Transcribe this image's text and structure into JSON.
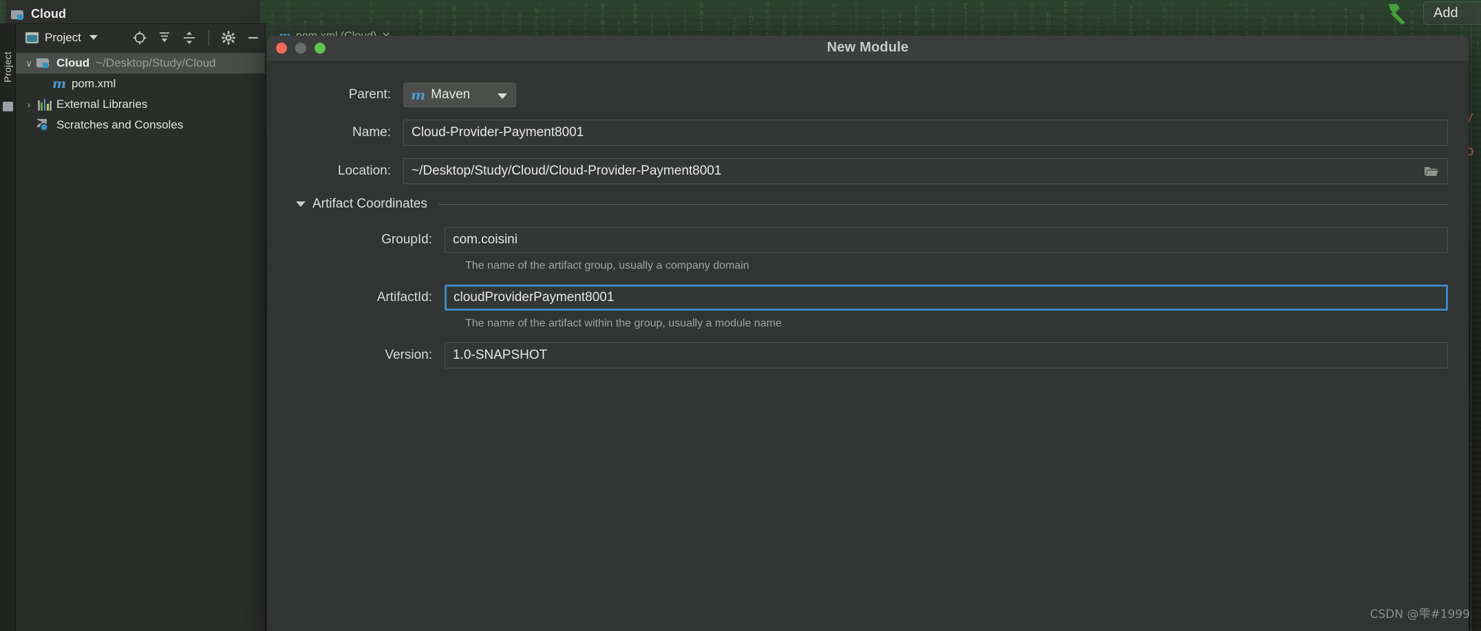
{
  "ide": {
    "project_badge": {
      "label": "Cloud",
      "icon": "folder-icon"
    },
    "topbar": {
      "build_icon": "hammer-icon",
      "add_button": "Add"
    },
    "tool_strip": {
      "label": "Project"
    },
    "panel": {
      "tab_label": "Project",
      "tab_icon": "project-view-icon",
      "dropdown_icon": "chevron-down-icon",
      "toolbar_icons": [
        "locate-target-icon",
        "expand-all-icon",
        "collapse-all-icon",
        "settings-gear-icon",
        "minimize-icon"
      ]
    },
    "tree": [
      {
        "twisty": "⌄",
        "icon": "folder-icon",
        "label": "Cloud",
        "sub": "~/Desktop/Study/Cloud",
        "selected": true,
        "indent": 1
      },
      {
        "twisty": "",
        "icon": "maven-icon",
        "label": "pom.xml",
        "sub": "",
        "selected": false,
        "indent": 2
      },
      {
        "twisty": "›",
        "icon": "libraries-icon",
        "label": "External Libraries",
        "sub": "",
        "selected": false,
        "indent": 1
      },
      {
        "twisty": "",
        "icon": "scratches-icon",
        "label": "Scratches and Consoles",
        "sub": "",
        "selected": false,
        "indent": 1
      }
    ],
    "editor_tab": {
      "label": "pom.xml (Cloud)",
      "icon": "maven-icon",
      "close_icon": "close-icon"
    },
    "code_peek": [
      "/ .",
      "o"
    ]
  },
  "dialog": {
    "title": "New Module",
    "window_controls": {
      "close": "close-button",
      "minimize": "minimize-button",
      "zoom": "zoom-button"
    },
    "parent": {
      "label": "Parent:",
      "value": "Maven",
      "icon": "maven-icon"
    },
    "name": {
      "label": "Name:",
      "value": "Cloud-Provider-Payment8001"
    },
    "location": {
      "label": "Location:",
      "value": "~/Desktop/Study/Cloud/Cloud-Provider-Payment8001",
      "browse_icon": "folder-open-icon"
    },
    "artifact_section": {
      "title": "Artifact Coordinates",
      "twisty": "chevron-down-icon"
    },
    "group_id": {
      "label": "GroupId:",
      "value": "com.coisini",
      "hint": "The name of the artifact group, usually a company domain"
    },
    "artifact_id": {
      "label": "ArtifactId:",
      "value": "cloudProviderPayment8001",
      "hint": "The name of the artifact within the group, usually a module name",
      "focused": true
    },
    "version": {
      "label": "Version:",
      "value": "1.0-SNAPSHOT"
    }
  },
  "watermark": "CSDN @雫#1999",
  "colors": {
    "accent_blue": "#3e87c8",
    "maven_blue": "#4d9ccd",
    "dialog_bg": "#313432",
    "titlebar_bg": "#3b3e3c",
    "panel_bg": "#2b2d2b",
    "close_red": "#ef6a5b",
    "zoom_green": "#62c352",
    "hammer_green": "#49a23c"
  }
}
